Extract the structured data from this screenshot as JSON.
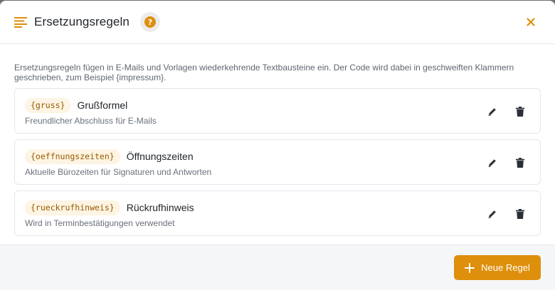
{
  "dialog": {
    "title": "Ersetzungsregeln",
    "help_glyph": "?",
    "intro": "Ersetzungsregeln fügen in E-Mails und Vorlagen wiederkehrende Textbausteine ein. Der Code wird dabei in geschweiften Klammern geschrieben, zum Beispiel {impressum}."
  },
  "rules": [
    {
      "code": "{gruss}",
      "name": "Grußformel",
      "description": "Freundlicher Abschluss für E-Mails"
    },
    {
      "code": "{oeffnungszeiten}",
      "name": "Öffnungszeiten",
      "description": "Aktuelle Bürozeiten für Signaturen und Antworten"
    },
    {
      "code": "{rueckrufhinweis}",
      "name": "Rückrufhinweis",
      "description": "Wird in Terminbestätigungen verwendet"
    }
  ],
  "footer": {
    "new_rule_label": "Neue Regel"
  },
  "colors": {
    "accent": "#de8f0c",
    "chip_bg": "#fdf4e3",
    "chip_text": "#9a5b00"
  },
  "icons": [
    "text-lines-icon",
    "help-icon",
    "close-icon",
    "pencil-icon",
    "trash-icon",
    "plus-icon"
  ]
}
